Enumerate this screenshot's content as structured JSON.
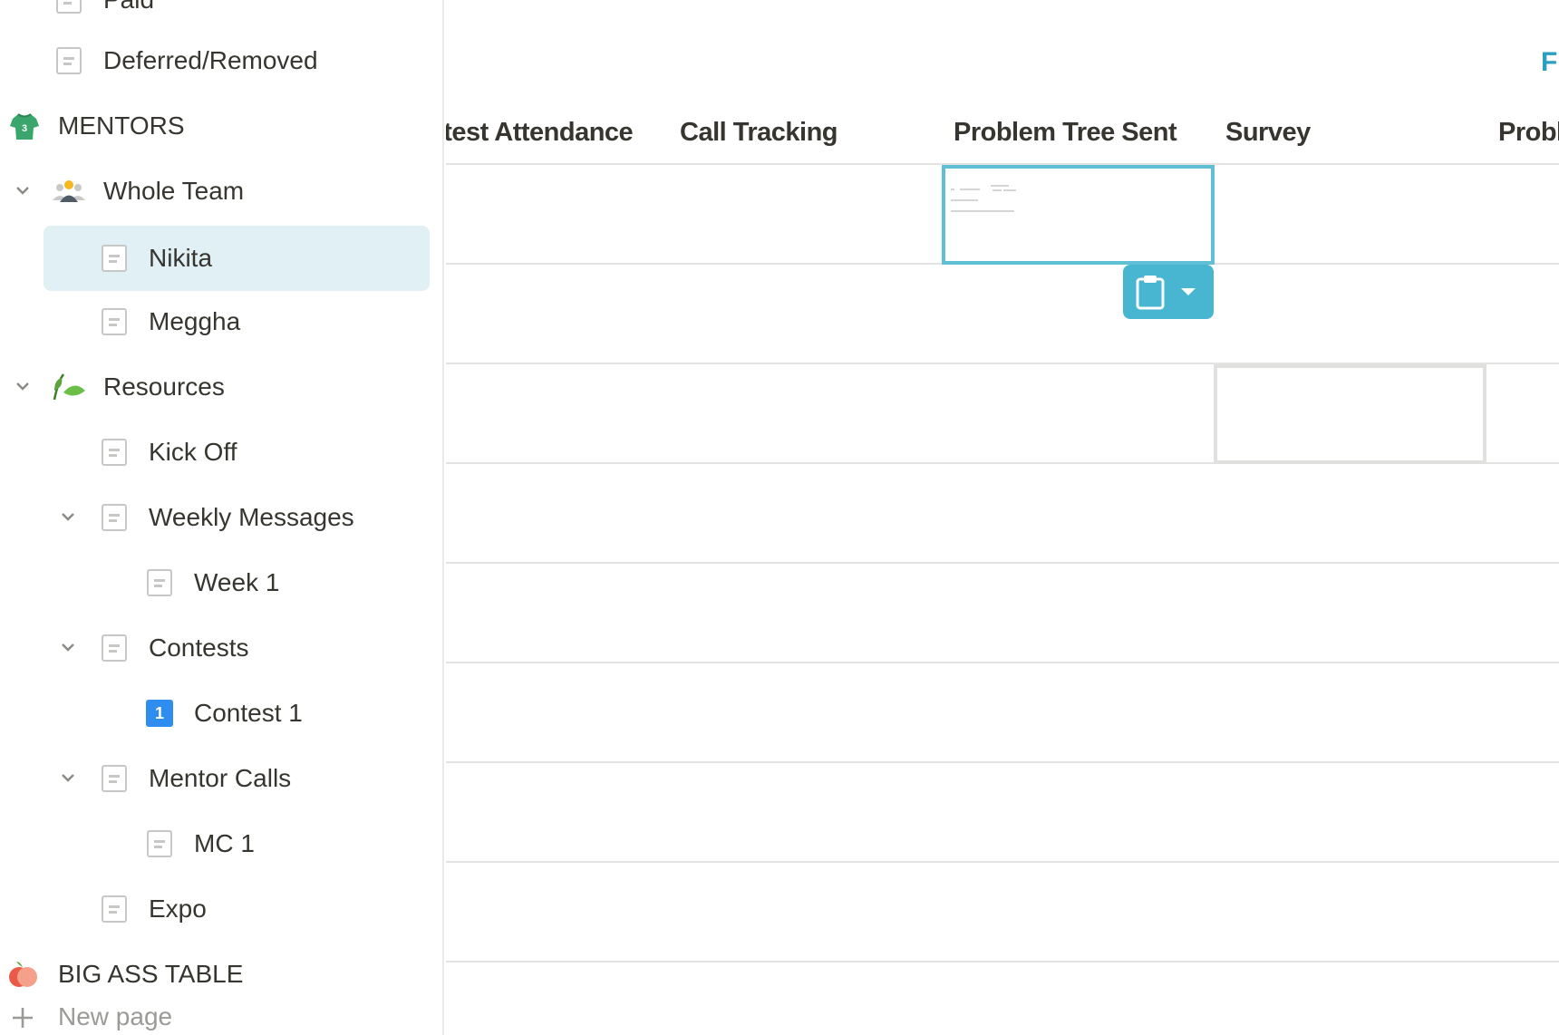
{
  "sidebar": {
    "items": [
      {
        "label": "Paid"
      },
      {
        "label": "Deferred/Removed"
      },
      {
        "label": "MENTORS"
      },
      {
        "label": "Whole Team"
      },
      {
        "label": "Nikita"
      },
      {
        "label": "Meggha"
      },
      {
        "label": "Resources"
      },
      {
        "label": "Kick Off"
      },
      {
        "label": "Weekly Messages"
      },
      {
        "label": "Week 1"
      },
      {
        "label": "Contests"
      },
      {
        "label": "Contest 1"
      },
      {
        "label": "Mentor Calls"
      },
      {
        "label": "MC 1"
      },
      {
        "label": "Expo"
      },
      {
        "label": "BIG ASS TABLE"
      }
    ],
    "new_page_label": "New page",
    "contest_badge": "1",
    "mentors_badge": "3"
  },
  "table": {
    "filter_label": "Fi",
    "columns": [
      {
        "label": "ntest Attendance"
      },
      {
        "label": "Call Tracking"
      },
      {
        "label": "Problem Tree Sent"
      },
      {
        "label": "Survey"
      },
      {
        "label": "Proble"
      }
    ]
  },
  "colors": {
    "accent": "#48b6d0",
    "selected_bg": "#e1f0f4",
    "link": "#2a9fc0"
  }
}
